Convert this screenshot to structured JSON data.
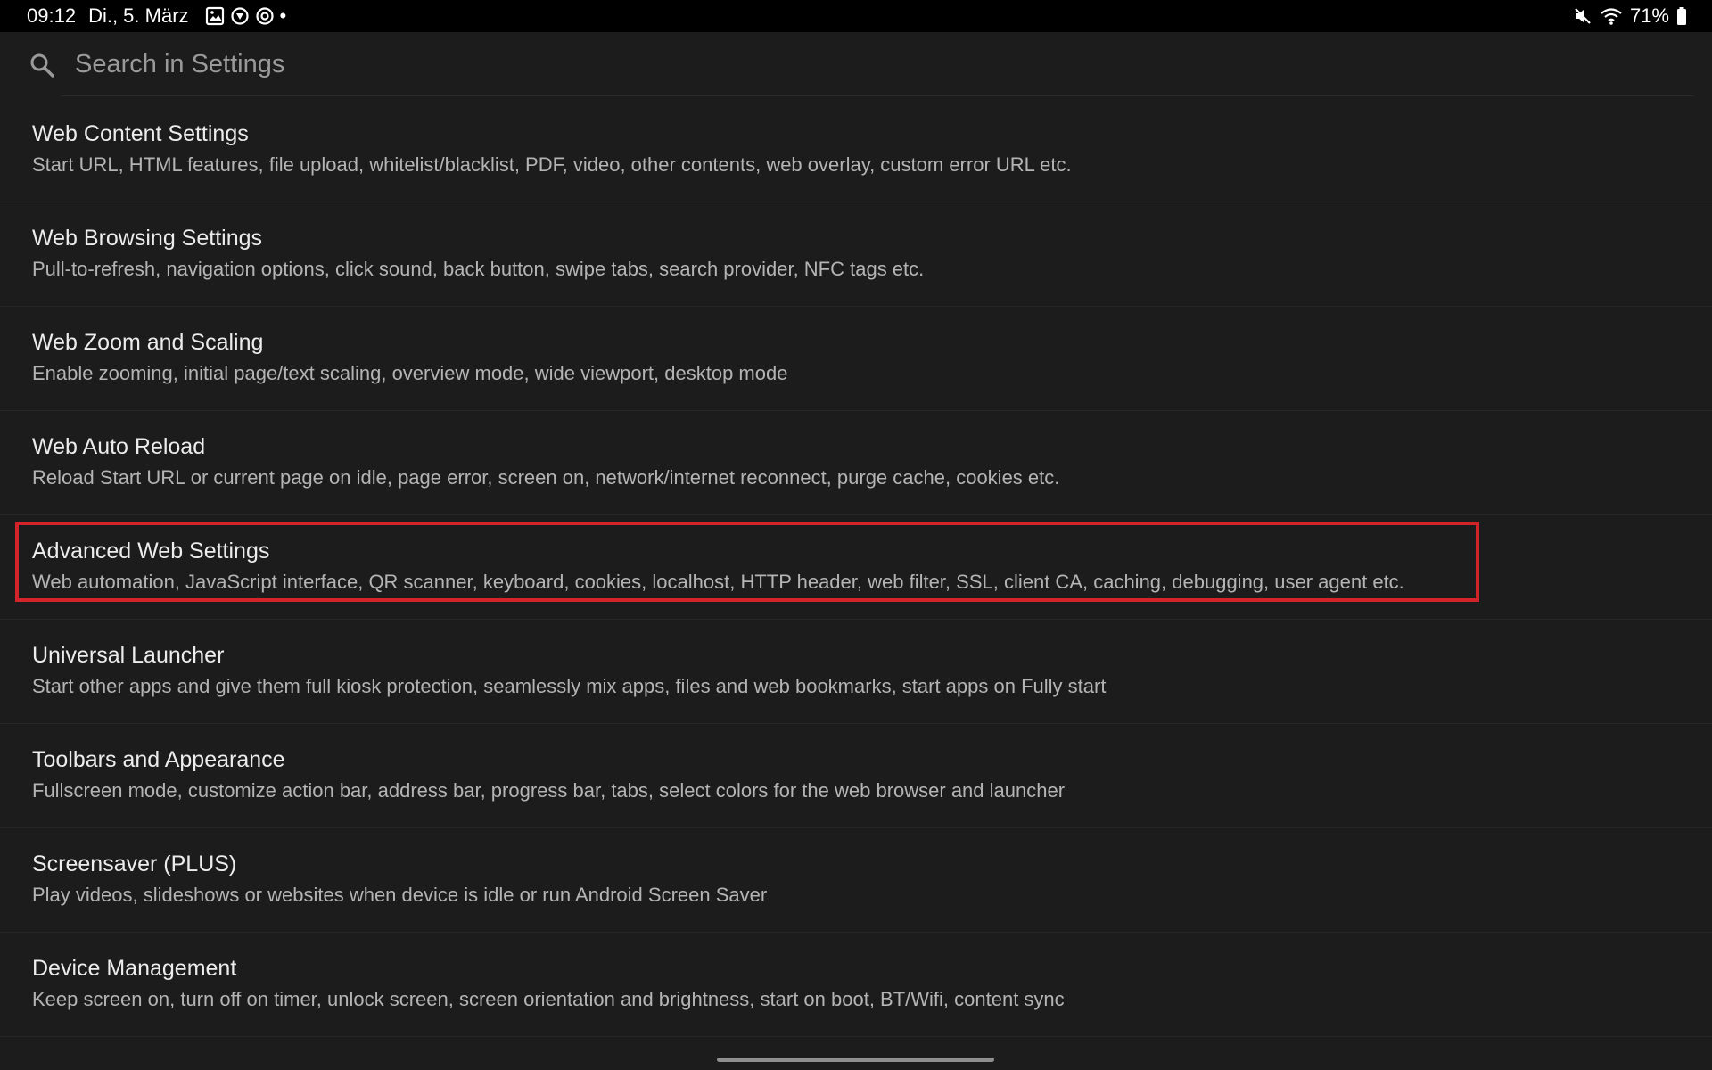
{
  "status_bar": {
    "time": "09:12",
    "date": "Di., 5. März",
    "notification_icons": [
      "image-icon",
      "record-icon",
      "sync-icon",
      "dot-icon"
    ],
    "dot": "•",
    "battery_percent": "71%",
    "right_icons": [
      "mute-icon",
      "wifi-icon",
      "battery-icon"
    ]
  },
  "search": {
    "placeholder": "Search in Settings",
    "icon": "search-icon"
  },
  "settings": [
    {
      "title": "Web Content Settings",
      "summary": "Start URL, HTML features, file upload, whitelist/blacklist, PDF, video, other contents, web overlay, custom error URL etc."
    },
    {
      "title": "Web Browsing Settings",
      "summary": "Pull-to-refresh, navigation options, click sound, back button, swipe tabs, search provider, NFC tags etc."
    },
    {
      "title": "Web Zoom and Scaling",
      "summary": "Enable zooming, initial page/text scaling, overview mode, wide viewport, desktop mode"
    },
    {
      "title": "Web Auto Reload",
      "summary": "Reload Start URL or current page on idle, page error, screen on, network/internet reconnect, purge cache, cookies etc."
    },
    {
      "title": "Advanced Web Settings",
      "summary": "Web automation, JavaScript interface, QR scanner, keyboard, cookies, localhost, HTTP header, web filter, SSL, client CA, caching, debugging, user agent etc.",
      "highlighted": true
    },
    {
      "title": "Universal Launcher",
      "summary": "Start other apps and give them full kiosk protection, seamlessly mix apps, files and web bookmarks, start apps on Fully start"
    },
    {
      "title": "Toolbars and Appearance",
      "summary": "Fullscreen mode, customize action bar, address bar, progress bar, tabs, select colors for the web browser and launcher"
    },
    {
      "title": "Screensaver (PLUS)",
      "summary": "Play videos, slideshows or websites when device is idle or run Android Screen Saver"
    },
    {
      "title": "Device Management",
      "summary": "Keep screen on, turn off on timer, unlock screen, screen orientation and brightness, start on boot, BT/Wifi, content sync"
    }
  ],
  "colors": {
    "background": "#1c1c1c",
    "status_bar": "#000000",
    "highlight_border": "#d4242b",
    "title_text": "#ececec",
    "summary_text": "#b4b4b4"
  }
}
